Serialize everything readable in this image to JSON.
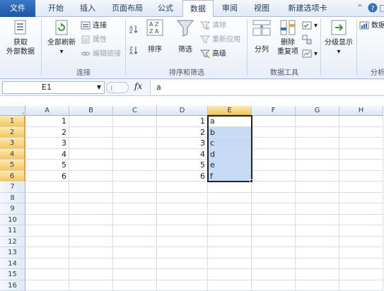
{
  "tabs": [
    {
      "label": "文件",
      "name": "tab-file"
    },
    {
      "label": "开始",
      "name": "tab-home"
    },
    {
      "label": "插入",
      "name": "tab-insert"
    },
    {
      "label": "页面布局",
      "name": "tab-page-layout"
    },
    {
      "label": "公式",
      "name": "tab-formulas"
    },
    {
      "label": "数据",
      "name": "tab-data"
    },
    {
      "label": "审阅",
      "name": "tab-review"
    },
    {
      "label": "视图",
      "name": "tab-view"
    },
    {
      "label": "新建选项卡",
      "name": "tab-new"
    }
  ],
  "ribbon": {
    "get_external_data": {
      "line1": "获取",
      "line2": "外部数据"
    },
    "connections": {
      "refresh_all": "全部刷新",
      "connections": "连接",
      "properties": "属性",
      "edit_links": "编辑链接",
      "group_label": "连接"
    },
    "sort_filter": {
      "sort": "排序",
      "filter": "筛选",
      "clear": "清除",
      "reapply": "重新应用",
      "advanced": "高级",
      "group_label": "排序和筛选"
    },
    "data_tools": {
      "text_to_columns": "分列",
      "remove_duplicates_line1": "删除",
      "remove_duplicates_line2": "重复项",
      "group_label": "数据工具"
    },
    "outline": {
      "label": "分级显示"
    },
    "partial_right_label": "数据",
    "partial_group_label": "分析"
  },
  "formula_bar": {
    "name_box": "E1",
    "fx": "fx",
    "content": "a"
  },
  "columns": [
    "A",
    "B",
    "C",
    "D",
    "E",
    "F",
    "G",
    "H"
  ],
  "rows": [
    "1",
    "2",
    "3",
    "4",
    "5",
    "6",
    "7",
    "8",
    "9",
    "10",
    "11",
    "12",
    "13",
    "14",
    "15",
    "16"
  ],
  "cells": {
    "A": [
      "1",
      "2",
      "3",
      "4",
      "5",
      "6"
    ],
    "D": [
      "1",
      "2",
      "3",
      "4",
      "5",
      "6"
    ],
    "E": [
      "a",
      "b",
      "c",
      "d",
      "e",
      "f"
    ]
  },
  "colors": {
    "selection": "#c5dbf5",
    "file_tab": "#1d56a5",
    "header_highlight": "#f5c65e"
  }
}
